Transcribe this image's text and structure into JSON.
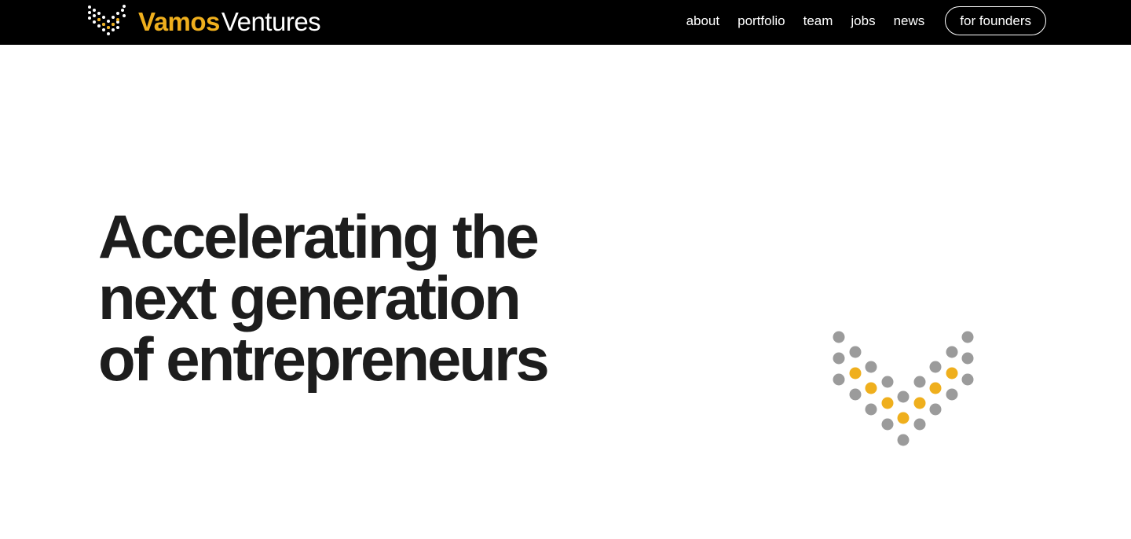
{
  "brand": {
    "name_part_1": "Vamos",
    "name_part_2": "Ventures",
    "logo_icon": "dotted-v-logo-icon",
    "colors": {
      "accent": "#EFAF1D",
      "dot_gray": "#9B9B9B",
      "header_bg": "#000000",
      "text_dark": "#1d1d1d"
    }
  },
  "nav": {
    "links": [
      {
        "label": "about"
      },
      {
        "label": "portfolio"
      },
      {
        "label": "team"
      },
      {
        "label": "jobs"
      },
      {
        "label": "news"
      }
    ],
    "cta_label": "for founders"
  },
  "hero": {
    "headline_lines": [
      "Accelerating the",
      "next generation",
      "of entrepreneurs"
    ],
    "illustration_icon": "dotted-v-graphic-icon"
  }
}
